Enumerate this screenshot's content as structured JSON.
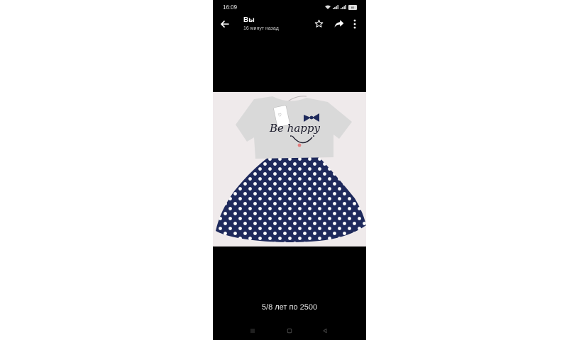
{
  "status_bar": {
    "time": "16:09",
    "battery": "80"
  },
  "header": {
    "title": "Вы",
    "subtitle": "16 минут назад"
  },
  "photo": {
    "print_text": "Be happy"
  },
  "caption": "5/8 лет по 2500",
  "colors": {
    "background": "#000000",
    "dress_skirt": "#1f2a5c",
    "dress_top": "#d9d9d9"
  }
}
